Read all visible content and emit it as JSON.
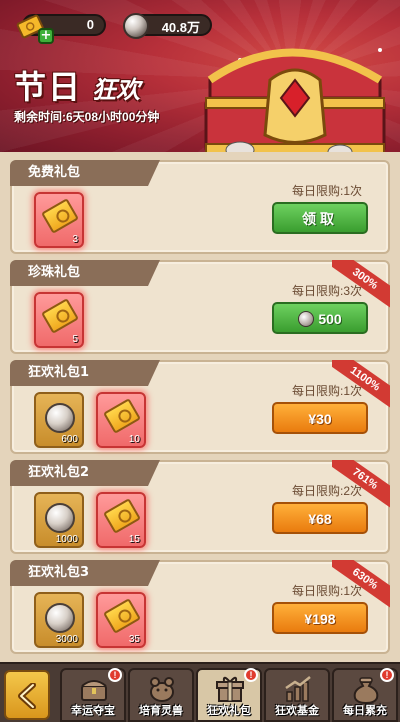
{
  "header": {
    "ticket_count": "0",
    "pearl_count": "40.8万",
    "title_main": "节日",
    "title_sub": "狂欢",
    "timer": "剩余时间:6天08小时00分钟"
  },
  "packs": [
    {
      "name": "免费礼包",
      "limit": "每日限购:1次",
      "ribbon": "",
      "button": "领取",
      "button_style": "green",
      "items": [
        {
          "type": "ticket",
          "qty": "3"
        }
      ]
    },
    {
      "name": "珍珠礼包",
      "limit": "每日限购:3次",
      "ribbon": "300%",
      "button": "500",
      "button_style": "green-pearl",
      "items": [
        {
          "type": "ticket",
          "qty": "5"
        }
      ]
    },
    {
      "name": "狂欢礼包1",
      "limit": "每日限购:1次",
      "ribbon": "1100%",
      "button": "¥30",
      "button_style": "orange",
      "items": [
        {
          "type": "pearl",
          "qty": "600"
        },
        {
          "type": "ticket",
          "qty": "10"
        }
      ]
    },
    {
      "name": "狂欢礼包2",
      "limit": "每日限购:2次",
      "ribbon": "761%",
      "button": "¥68",
      "button_style": "orange",
      "items": [
        {
          "type": "pearl",
          "qty": "1000"
        },
        {
          "type": "ticket",
          "qty": "15"
        }
      ]
    },
    {
      "name": "狂欢礼包3",
      "limit": "每日限购:1次",
      "ribbon": "630%",
      "button": "¥198",
      "button_style": "orange",
      "items": [
        {
          "type": "pearl",
          "qty": "3000"
        },
        {
          "type": "ticket",
          "qty": "35"
        }
      ]
    }
  ],
  "nav": {
    "tabs": [
      {
        "label": "幸运夺宝",
        "badge": "!",
        "icon": "treasure-chest-icon"
      },
      {
        "label": "培育灵兽",
        "badge": "",
        "icon": "beast-icon"
      },
      {
        "label": "狂欢礼包",
        "badge": "!",
        "icon": "gift-icon"
      },
      {
        "label": "狂欢基金",
        "badge": "",
        "icon": "growth-chart-icon"
      },
      {
        "label": "每日累充",
        "badge": "!",
        "icon": "money-bag-icon"
      }
    ]
  },
  "colors": {
    "accent_red": "#b7303a",
    "button_green": "#3a9d2f",
    "button_orange": "#e97b0e",
    "ribbon": "#d23a33"
  }
}
